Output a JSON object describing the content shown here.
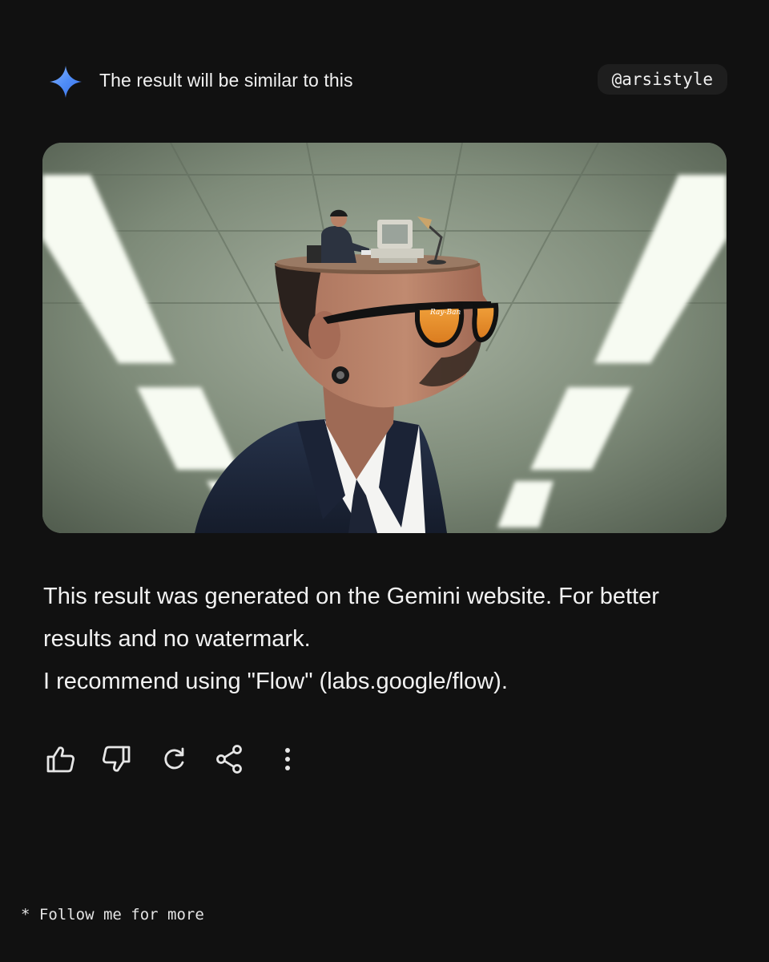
{
  "header": {
    "title": "The result will be similar to this",
    "handle": "@arsistyle",
    "star_icon": "gemini-sparkle-icon",
    "star_colors": [
      "#4f8df7",
      "#3b6fe6",
      "#8ab4ff"
    ]
  },
  "result_image": {
    "icon": "generated-image",
    "frame_lettering": "Ray-Ban"
  },
  "message": {
    "line1": "This result was generated on the Gemini website. For better results and no watermark.",
    "line2": "I recommend using \"Flow\" (labs.google/flow)."
  },
  "actions": [
    {
      "icon": "thumbs-up-icon"
    },
    {
      "icon": "thumbs-down-icon"
    },
    {
      "icon": "regenerate-icon"
    },
    {
      "icon": "share-icon"
    },
    {
      "icon": "more-vertical-icon"
    }
  ],
  "footer": {
    "note": "* Follow me for more"
  },
  "colors": {
    "background": "#111111",
    "text": "#f2f2f2",
    "chip": "#1e1e1e",
    "accent": "#4f8df7"
  }
}
